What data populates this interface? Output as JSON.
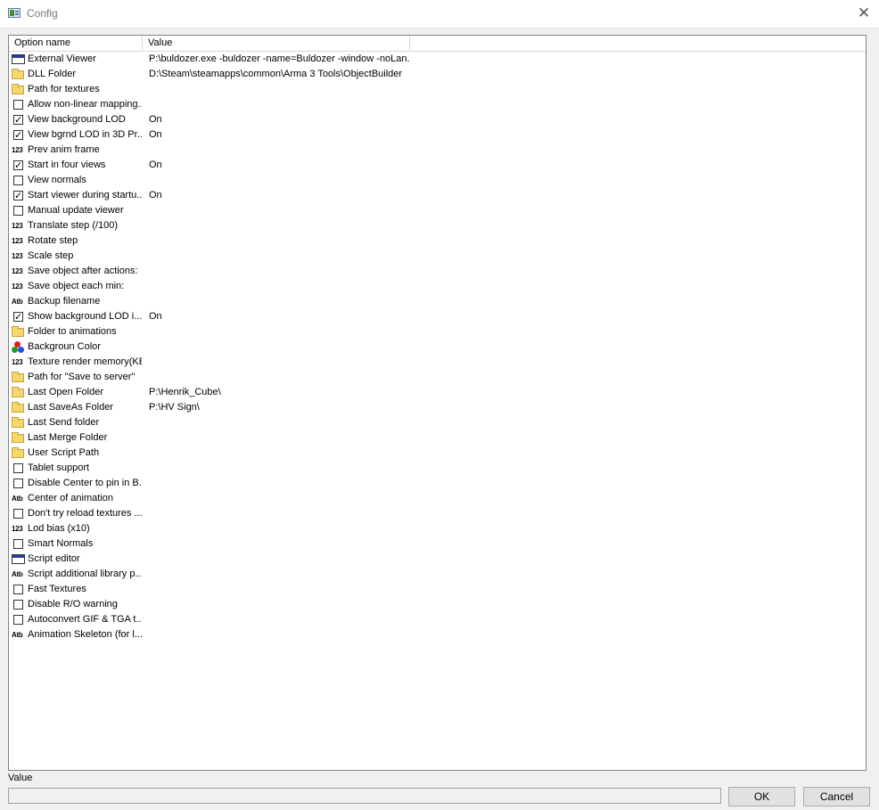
{
  "window": {
    "title": "Config",
    "close_glyph": "✕"
  },
  "list": {
    "columns": [
      "Option name",
      "Value"
    ],
    "rows": [
      {
        "icon": "window-icon",
        "name": "External Viewer",
        "value": "P:\\buldozer.exe -buldozer -name=Buldozer -window -noLan..."
      },
      {
        "icon": "folder-icon",
        "name": "DLL Folder",
        "value": "D:\\Steam\\steamapps\\common\\Arma 3 Tools\\ObjectBuilder"
      },
      {
        "icon": "folder-icon",
        "name": "Path for textures",
        "value": ""
      },
      {
        "icon": "checkbox-unchecked-icon",
        "name": "Allow non-linear mapping...",
        "value": ""
      },
      {
        "icon": "checkbox-checked-icon",
        "name": "View background LOD",
        "value": "On"
      },
      {
        "icon": "checkbox-checked-icon",
        "name": "View bgrnd LOD in 3D Pr...",
        "value": "On"
      },
      {
        "icon": "number-icon",
        "name": "Prev anim frame",
        "value": ""
      },
      {
        "icon": "checkbox-checked-icon",
        "name": "Start in four views",
        "value": "On"
      },
      {
        "icon": "checkbox-unchecked-icon",
        "name": "View normals",
        "value": ""
      },
      {
        "icon": "checkbox-checked-icon",
        "name": "Start viewer during startu...",
        "value": "On"
      },
      {
        "icon": "checkbox-unchecked-icon",
        "name": "Manual update viewer",
        "value": ""
      },
      {
        "icon": "number-icon",
        "name": "Translate step (/100)",
        "value": ""
      },
      {
        "icon": "number-icon",
        "name": "Rotate step",
        "value": ""
      },
      {
        "icon": "number-icon",
        "name": "Scale step",
        "value": ""
      },
      {
        "icon": "number-icon",
        "name": "Save object after actions:",
        "value": ""
      },
      {
        "icon": "number-icon",
        "name": "Save object each min:",
        "value": ""
      },
      {
        "icon": "text-icon",
        "name": "Backup filename",
        "value": ""
      },
      {
        "icon": "checkbox-checked-icon",
        "name": "Show background LOD i...",
        "value": "On"
      },
      {
        "icon": "folder-icon",
        "name": "Folder to animations",
        "value": ""
      },
      {
        "icon": "color-icon",
        "name": "Backgroun Color",
        "value": ""
      },
      {
        "icon": "number-icon",
        "name": "Texture render memory(KB)",
        "value": ""
      },
      {
        "icon": "folder-icon",
        "name": "Path for \"Save to server\"",
        "value": ""
      },
      {
        "icon": "folder-icon",
        "name": "Last Open Folder",
        "value": "P:\\Henrik_Cube\\"
      },
      {
        "icon": "folder-icon",
        "name": "Last SaveAs Folder",
        "value": "P:\\HV Sign\\"
      },
      {
        "icon": "folder-icon",
        "name": "Last Send folder",
        "value": ""
      },
      {
        "icon": "folder-icon",
        "name": "Last Merge Folder",
        "value": ""
      },
      {
        "icon": "folder-icon",
        "name": "User Script Path",
        "value": ""
      },
      {
        "icon": "checkbox-unchecked-icon",
        "name": "Tablet support",
        "value": ""
      },
      {
        "icon": "checkbox-unchecked-icon",
        "name": "Disable Center to pin in B...",
        "value": ""
      },
      {
        "icon": "text-icon",
        "name": "Center of animation",
        "value": ""
      },
      {
        "icon": "checkbox-unchecked-icon",
        "name": "Don't try reload textures ...",
        "value": ""
      },
      {
        "icon": "number-icon",
        "name": "Lod bias (x10)",
        "value": ""
      },
      {
        "icon": "checkbox-unchecked-icon",
        "name": "Smart Normals",
        "value": ""
      },
      {
        "icon": "window-icon",
        "name": "Script editor",
        "value": ""
      },
      {
        "icon": "text-icon",
        "name": "Script additional library p...",
        "value": ""
      },
      {
        "icon": "checkbox-unchecked-icon",
        "name": "Fast Textures",
        "value": ""
      },
      {
        "icon": "checkbox-unchecked-icon",
        "name": "Disable R/O warning",
        "value": ""
      },
      {
        "icon": "checkbox-unchecked-icon",
        "name": "Autoconvert GIF & TGA t...",
        "value": ""
      },
      {
        "icon": "text-icon",
        "name": "Animation Skeleton (for l...",
        "value": ""
      }
    ]
  },
  "icon_glyphs": {
    "number": "123",
    "text": "Atb",
    "check": "✓"
  },
  "footer": {
    "value_label": "Value",
    "value_field": "",
    "ok_label": "OK",
    "cancel_label": "Cancel"
  }
}
